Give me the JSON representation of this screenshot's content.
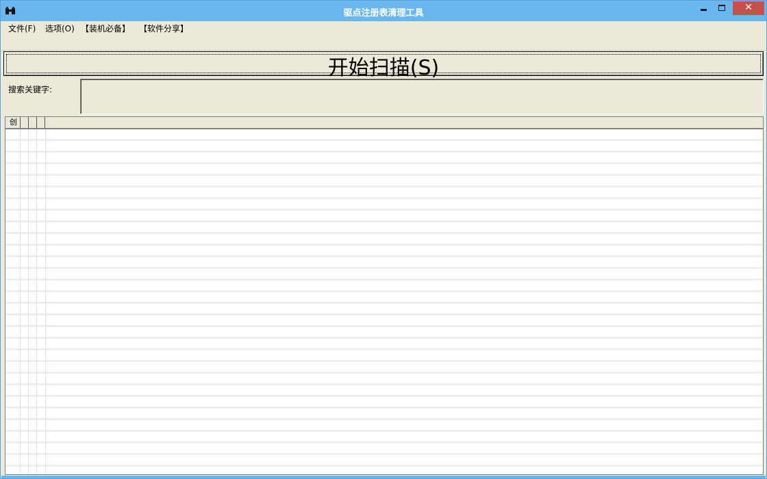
{
  "window": {
    "title": "驱点注册表清理工具",
    "icon": "binoculars-icon",
    "controls": {
      "minimize": "minimize-icon",
      "maximize": "maximize-icon",
      "close_label": "✕"
    }
  },
  "menu": {
    "items": [
      {
        "label": "文件(F)"
      },
      {
        "label": "选项(O)"
      },
      {
        "label": "【装机必备】"
      },
      {
        "label": "【软件分享】"
      }
    ]
  },
  "scan": {
    "label": "开始扫描(S)"
  },
  "search": {
    "label": "搜索关键字:",
    "value": ""
  },
  "list": {
    "columns": [
      {
        "label": "创"
      },
      {
        "label": ""
      },
      {
        "label": ""
      },
      {
        "label": ""
      }
    ]
  },
  "colors": {
    "titlebar": "#6ab7ef",
    "close": "#c7504d",
    "face": "#ece9d8"
  }
}
